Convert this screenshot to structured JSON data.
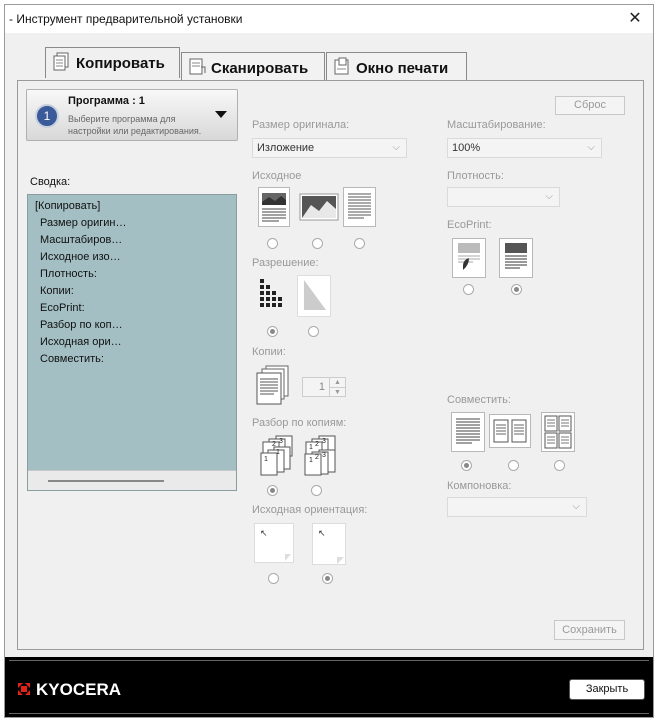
{
  "window": {
    "title": "- Инструмент предварительной установки",
    "close_glyph": "✕"
  },
  "tabs": [
    {
      "label": "Копировать",
      "icon": "copy-icon",
      "active": true
    },
    {
      "label": "Сканировать",
      "icon": "scan-icon",
      "active": false
    },
    {
      "label": "Окно печати",
      "icon": "print-box-icon",
      "active": false
    }
  ],
  "program": {
    "number": "1",
    "title": "Программа : 1",
    "hint": "Выберите программа для настройки или редактирования."
  },
  "reset_label": "Сброс",
  "summary": {
    "label": "Сводка:",
    "items": [
      "[Копировать]",
      "Размер оригин…",
      "Масштабиров…",
      "Исходное изо…",
      "Плотность:",
      "Копии:",
      "EcoPrint:",
      "Разбор по коп…",
      "Исходная ори…",
      "Совместить:"
    ]
  },
  "original_size": {
    "label": "Размер оригинала:",
    "value": "Изложение"
  },
  "zoom": {
    "label": "Масштабирование:",
    "value": "100%"
  },
  "original_image": {
    "label": "Исходное",
    "selected": null
  },
  "density": {
    "label": "Плотность:",
    "value": ""
  },
  "ecoprint": {
    "label": "EcoPrint:",
    "selected": 1
  },
  "resolution": {
    "label": "Разрешение:",
    "selected": 0
  },
  "copies": {
    "label": "Копии:",
    "value": "1"
  },
  "collate": {
    "label": "Разбор по копиям:",
    "selected": 0
  },
  "combine": {
    "label": "Совместить:",
    "selected": 0
  },
  "layout": {
    "label": "Компоновка:",
    "value": ""
  },
  "orientation": {
    "label": "Исходная ориентация:",
    "selected": 1
  },
  "save_label": "Сохранить",
  "footer": {
    "brand": "KYOCERA",
    "close_label": "Закрыть"
  },
  "colors": {
    "summary_bg": "#a3bfc3",
    "footer_bg": "#000000",
    "program_badge": "#3a5a9a"
  }
}
